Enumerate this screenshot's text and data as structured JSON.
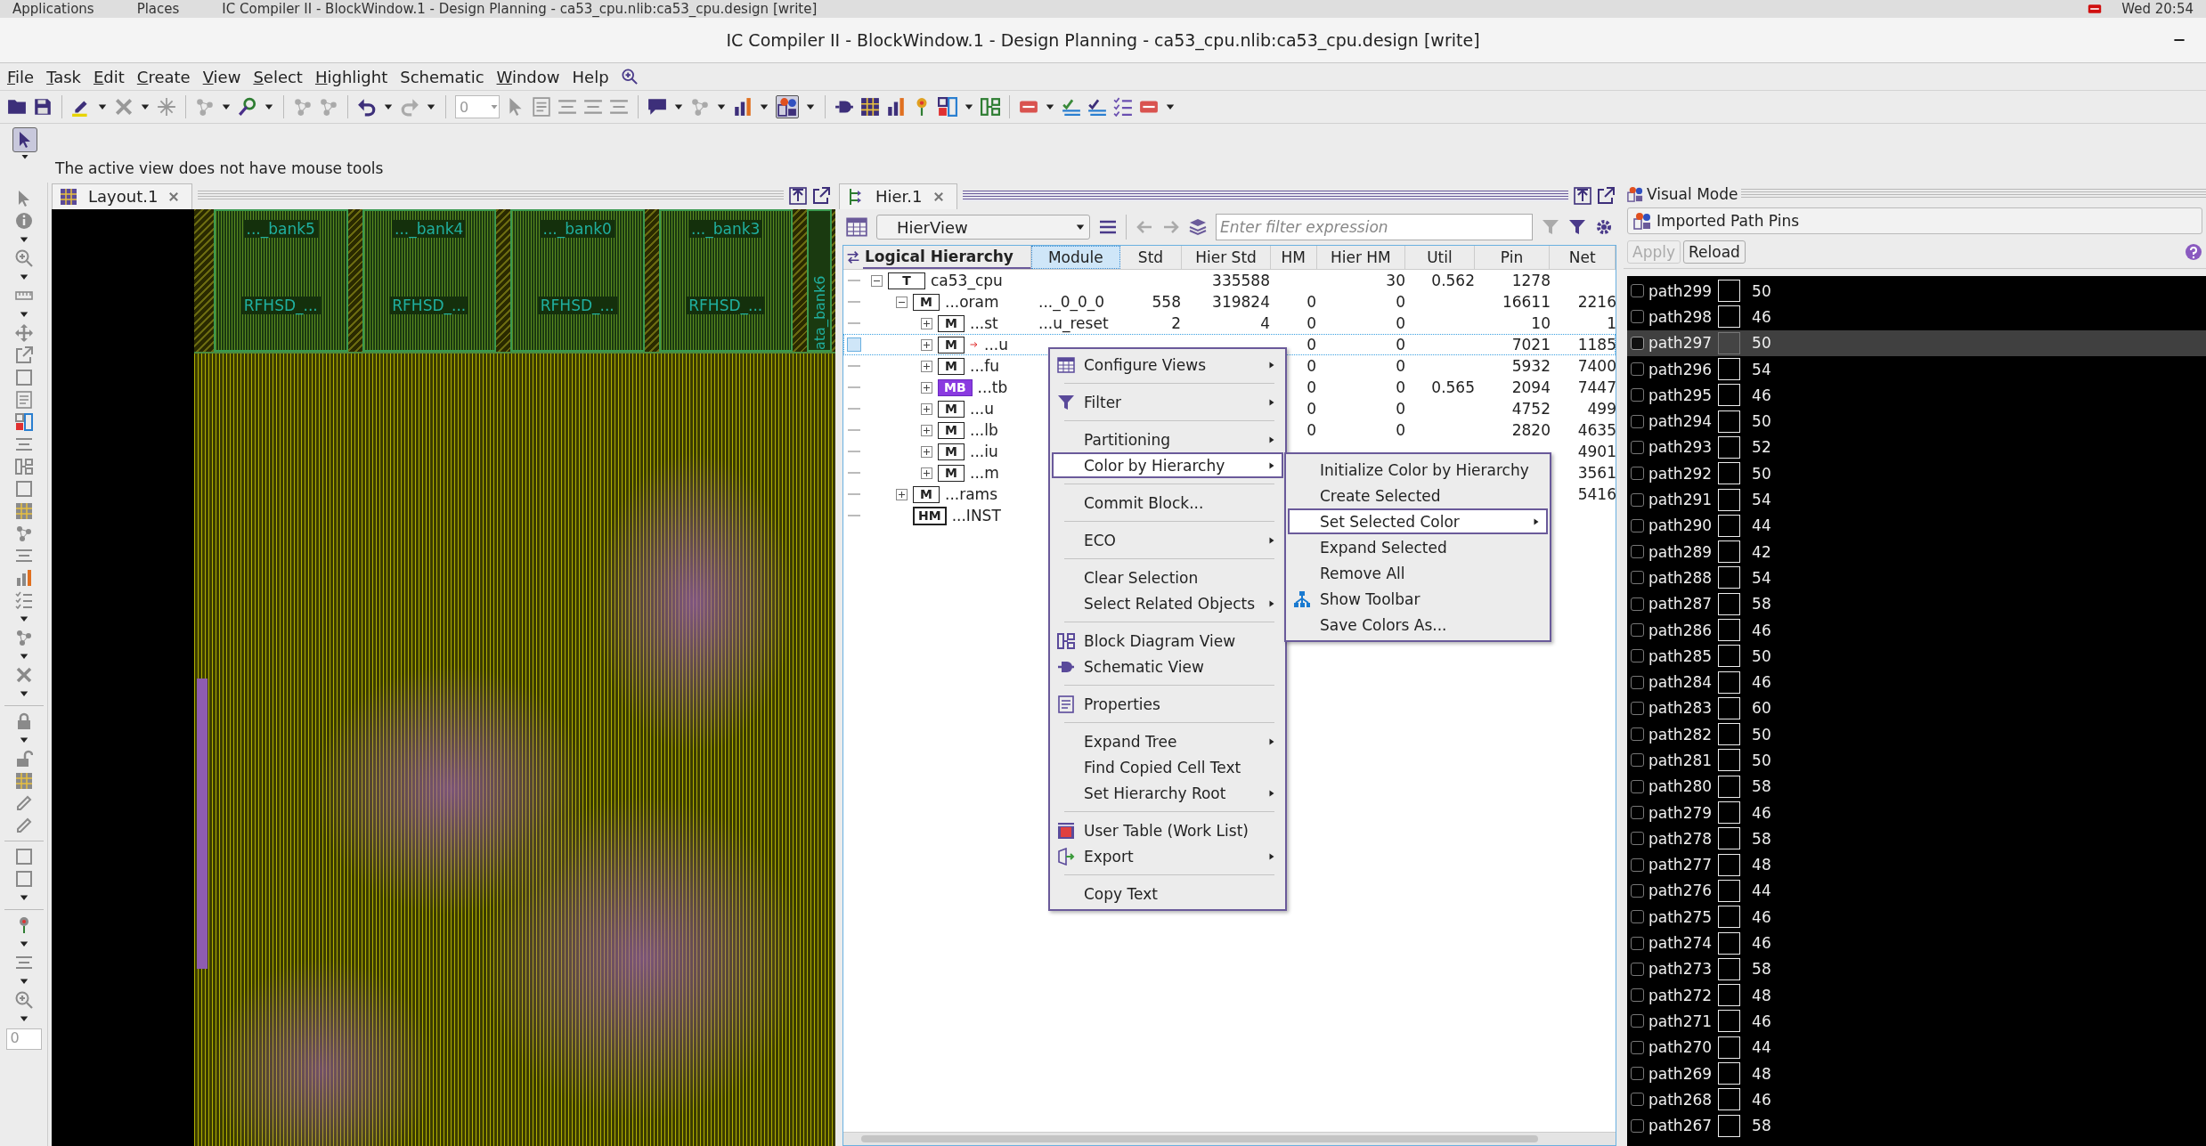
{
  "system_bar": {
    "items": [
      "Applications",
      "Places",
      "IC Compiler II - BlockWindow.1 - Design Planning - ca53_cpu.nlib:ca53_cpu.design [write]"
    ],
    "clock": "Wed 20:54"
  },
  "window": {
    "title": "IC Compiler II - BlockWindow.1 - Design Planning - ca53_cpu.nlib:ca53_cpu.design [write]"
  },
  "menu_bar": [
    {
      "label": "File",
      "mnemonic": true
    },
    {
      "label": "Task",
      "mnemonic": true
    },
    {
      "label": "Edit",
      "mnemonic": true
    },
    {
      "label": "Create",
      "mnemonic": true
    },
    {
      "label": "View",
      "mnemonic": true
    },
    {
      "label": "Select",
      "mnemonic": true
    },
    {
      "label": "Highlight",
      "mnemonic": true
    },
    {
      "label": "Schematic",
      "mnemonic": false
    },
    {
      "label": "Window",
      "mnemonic": true
    },
    {
      "label": "Help",
      "mnemonic": false
    }
  ],
  "toolbar": {
    "spin_value": "0"
  },
  "mouse_tools": {
    "message": "The active view does not have mouse tools"
  },
  "tool_strip": {
    "field_value": "0"
  },
  "layout_panel": {
    "tab": {
      "label": "Layout.1",
      "selected": true
    },
    "banks": [
      {
        "name": "..._bank5",
        "cell": "RFHSD_..."
      },
      {
        "name": "..._bank4",
        "cell": "RFHSD_..."
      },
      {
        "name": "..._bank0",
        "cell": "RFHSD_..."
      },
      {
        "name": "..._bank3",
        "cell": "RFHSD_..."
      }
    ],
    "side_label": "ata_bank6"
  },
  "hier_panel": {
    "tab": {
      "label": "Hier.1",
      "selected": true
    },
    "view": "HierView",
    "filter": {
      "placeholder": "Enter filter expression"
    },
    "columns": [
      {
        "label": "Logical Hierarchy",
        "selected": false
      },
      {
        "label": "Module",
        "selected": true
      },
      {
        "label": "Std",
        "selected": false
      },
      {
        "label": "Hier Std",
        "selected": false
      },
      {
        "label": "HM",
        "selected": false
      },
      {
        "label": "Hier HM",
        "selected": false
      },
      {
        "label": "Util",
        "selected": false
      },
      {
        "label": "Pin",
        "selected": false
      },
      {
        "label": "Net",
        "selected": false
      }
    ],
    "tree": [
      {
        "badge": "T",
        "kind": "top",
        "name": "ca53_cpu",
        "expanded": true,
        "selected": false,
        "cells": {
          "hier_std": "335588",
          "hier_hm": "30",
          "util": "0.562",
          "pin": "1278"
        },
        "children": [
          {
            "badge": "M",
            "kind": "module",
            "name": "...oram",
            "expanded": true,
            "selected": false,
            "cells": {
              "module": "..._0_0_0",
              "std": "558",
              "hier_std": "319824",
              "hm": "0",
              "hier_hm": "0",
              "pin": "16611",
              "net": "2216"
            },
            "children": [
              {
                "badge": "M",
                "kind": "module",
                "name": "...st",
                "expanded": false,
                "selected": false,
                "cells": {
                  "module": "...u_reset",
                  "std": "2",
                  "hier_std": "4",
                  "hm": "0",
                  "hier_hm": "0",
                  "pin": "10",
                  "net": "1"
                }
              },
              {
                "badge": "M",
                "kind": "module",
                "name": "...u",
                "expanded": false,
                "selected": true,
                "cells": {
                  "hm": "0",
                  "hier_hm": "0",
                  "pin": "7021",
                  "net": "1185"
                }
              },
              {
                "badge": "M",
                "kind": "module",
                "name": "...fu",
                "expanded": false,
                "selected": false,
                "cells": {
                  "hm": "0",
                  "hier_hm": "0",
                  "pin": "5932",
                  "net": "7400"
                }
              },
              {
                "badge": "MB",
                "kind": "macro_block",
                "name": "...tb",
                "expanded": false,
                "selected": false,
                "cells": {
                  "hm": "0",
                  "hier_hm": "0",
                  "util": "0.565",
                  "pin": "2094",
                  "net": "7447"
                }
              },
              {
                "badge": "M",
                "kind": "module",
                "name": "...u",
                "expanded": false,
                "selected": false,
                "cells": {
                  "hm": "0",
                  "hier_hm": "0",
                  "pin": "4752",
                  "net": "499"
                }
              },
              {
                "badge": "M",
                "kind": "module",
                "name": "...lb",
                "expanded": false,
                "selected": false,
                "cells": {
                  "hm": "0",
                  "hier_hm": "0",
                  "pin": "2820",
                  "net": "4635"
                }
              },
              {
                "badge": "M",
                "kind": "module",
                "name": "...iu",
                "expanded": false,
                "selected": false,
                "cells": {
                  "net": "4901"
                }
              },
              {
                "badge": "M",
                "kind": "module",
                "name": "...m",
                "expanded": false,
                "selected": false,
                "cells": {
                  "net": "3561"
                }
              }
            ]
          },
          {
            "badge": "M",
            "kind": "module",
            "name": "...rams",
            "expanded": false,
            "selected": false,
            "cells": {
              "net": "5416"
            }
          },
          {
            "badge": "HM",
            "kind": "hard_macro",
            "name": "...INST",
            "selected": false
          }
        ]
      }
    ]
  },
  "context_menu": {
    "items": [
      {
        "kind": "item",
        "label": "Configure Views",
        "submenu": true,
        "selected": false
      },
      {
        "kind": "separator"
      },
      {
        "kind": "item",
        "label": "Filter",
        "submenu": true,
        "selected": false
      },
      {
        "kind": "separator"
      },
      {
        "kind": "item",
        "label": "Partitioning",
        "submenu": true,
        "selected": false
      },
      {
        "kind": "item",
        "label": "Color by Hierarchy",
        "submenu": true,
        "selected": true
      },
      {
        "kind": "separator"
      },
      {
        "kind": "item",
        "label": "Commit Block...",
        "submenu": false,
        "selected": false
      },
      {
        "kind": "separator"
      },
      {
        "kind": "item",
        "label": "ECO",
        "submenu": true,
        "selected": false
      },
      {
        "kind": "separator"
      },
      {
        "kind": "item",
        "label": "Clear Selection",
        "submenu": false,
        "selected": false
      },
      {
        "kind": "item",
        "label": "Select Related Objects",
        "submenu": true,
        "selected": false
      },
      {
        "kind": "separator"
      },
      {
        "kind": "item",
        "label": "Block Diagram View",
        "submenu": false,
        "selected": false
      },
      {
        "kind": "item",
        "label": "Schematic View",
        "submenu": false,
        "selected": false
      },
      {
        "kind": "separator"
      },
      {
        "kind": "item",
        "label": "Properties",
        "submenu": false,
        "selected": false
      },
      {
        "kind": "separator"
      },
      {
        "kind": "item",
        "label": "Expand Tree",
        "submenu": true,
        "selected": false
      },
      {
        "kind": "item",
        "label": "Find Copied Cell Text",
        "submenu": false,
        "selected": false
      },
      {
        "kind": "item",
        "label": "Set Hierarchy Root",
        "submenu": true,
        "selected": false
      },
      {
        "kind": "separator"
      },
      {
        "kind": "item",
        "label": "User Table (Work List)",
        "submenu": false,
        "selected": false
      },
      {
        "kind": "item",
        "label": "Export",
        "submenu": true,
        "selected": false
      },
      {
        "kind": "separator"
      },
      {
        "kind": "item",
        "label": "Copy Text",
        "submenu": false,
        "selected": false
      }
    ]
  },
  "submenu": {
    "items": [
      {
        "kind": "item",
        "label": "Initialize Color by Hierarchy",
        "submenu": false,
        "selected": false
      },
      {
        "kind": "item",
        "label": "Create Selected",
        "submenu": false,
        "selected": false
      },
      {
        "kind": "item",
        "label": "Set Selected Color",
        "submenu": true,
        "selected": true
      },
      {
        "kind": "item",
        "label": "Expand Selected",
        "submenu": false,
        "selected": false
      },
      {
        "kind": "item",
        "label": "Remove All",
        "submenu": false,
        "selected": false
      },
      {
        "kind": "item",
        "label": "Show Toolbar",
        "submenu": false,
        "selected": false
      },
      {
        "kind": "item",
        "label": "Save Colors As...",
        "submenu": false,
        "selected": false
      }
    ]
  },
  "visual_mode": {
    "title": "Visual Mode",
    "mode": "Imported Path Pins",
    "buttons": [
      {
        "label": "Apply",
        "disabled": true
      },
      {
        "label": "Reload",
        "disabled": false
      }
    ],
    "paths": [
      {
        "name": "path299",
        "count": "50",
        "checked": false,
        "selected": false
      },
      {
        "name": "path298",
        "count": "46",
        "checked": false,
        "selected": false
      },
      {
        "name": "path297",
        "count": "50",
        "checked": false,
        "selected": true
      },
      {
        "name": "path296",
        "count": "54",
        "checked": false,
        "selected": false
      },
      {
        "name": "path295",
        "count": "46",
        "checked": false,
        "selected": false
      },
      {
        "name": "path294",
        "count": "50",
        "checked": false,
        "selected": false
      },
      {
        "name": "path293",
        "count": "52",
        "checked": false,
        "selected": false
      },
      {
        "name": "path292",
        "count": "50",
        "checked": false,
        "selected": false
      },
      {
        "name": "path291",
        "count": "54",
        "checked": false,
        "selected": false
      },
      {
        "name": "path290",
        "count": "44",
        "checked": false,
        "selected": false
      },
      {
        "name": "path289",
        "count": "42",
        "checked": false,
        "selected": false
      },
      {
        "name": "path288",
        "count": "54",
        "checked": false,
        "selected": false
      },
      {
        "name": "path287",
        "count": "58",
        "checked": false,
        "selected": false
      },
      {
        "name": "path286",
        "count": "46",
        "checked": false,
        "selected": false
      },
      {
        "name": "path285",
        "count": "50",
        "checked": false,
        "selected": false
      },
      {
        "name": "path284",
        "count": "46",
        "checked": false,
        "selected": false
      },
      {
        "name": "path283",
        "count": "60",
        "checked": false,
        "selected": false
      },
      {
        "name": "path282",
        "count": "50",
        "checked": false,
        "selected": false
      },
      {
        "name": "path281",
        "count": "50",
        "checked": false,
        "selected": false
      },
      {
        "name": "path280",
        "count": "58",
        "checked": false,
        "selected": false
      },
      {
        "name": "path279",
        "count": "46",
        "checked": false,
        "selected": false
      },
      {
        "name": "path278",
        "count": "58",
        "checked": false,
        "selected": false
      },
      {
        "name": "path277",
        "count": "48",
        "checked": false,
        "selected": false
      },
      {
        "name": "path276",
        "count": "44",
        "checked": false,
        "selected": false
      },
      {
        "name": "path275",
        "count": "46",
        "checked": false,
        "selected": false
      },
      {
        "name": "path274",
        "count": "46",
        "checked": false,
        "selected": false
      },
      {
        "name": "path273",
        "count": "58",
        "checked": false,
        "selected": false
      },
      {
        "name": "path272",
        "count": "48",
        "checked": false,
        "selected": false
      },
      {
        "name": "path271",
        "count": "46",
        "checked": false,
        "selected": false
      },
      {
        "name": "path270",
        "count": "44",
        "checked": false,
        "selected": false
      },
      {
        "name": "path269",
        "count": "48",
        "checked": false,
        "selected": false
      },
      {
        "name": "path268",
        "count": "46",
        "checked": false,
        "selected": false
      },
      {
        "name": "path267",
        "count": "58",
        "checked": false,
        "selected": false
      }
    ]
  }
}
